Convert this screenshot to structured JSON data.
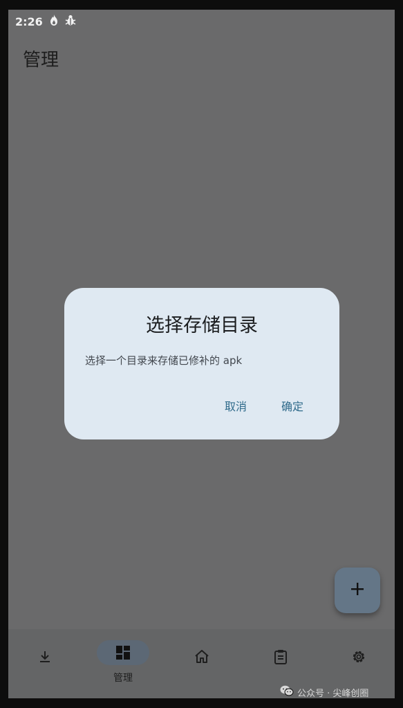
{
  "status_bar": {
    "time": "2:26",
    "notification_icons": [
      "flame-icon",
      "bug-icon"
    ]
  },
  "page": {
    "title": "管理"
  },
  "dialog": {
    "title": "选择存储目录",
    "message": "选择一个目录来存储已修补的 apk",
    "cancel_label": "取消",
    "confirm_label": "确定"
  },
  "fab": {
    "icon": "plus-icon"
  },
  "bottom_nav": {
    "items": [
      {
        "icon": "download-icon",
        "label": ""
      },
      {
        "icon": "dashboard-icon",
        "label": "管理",
        "active": true
      },
      {
        "icon": "home-icon",
        "label": ""
      },
      {
        "icon": "clipboard-icon",
        "label": ""
      },
      {
        "icon": "gear-icon",
        "label": ""
      }
    ]
  },
  "watermark": {
    "text": "公众号 · 尖峰创圈",
    "icon": "wechat-icon"
  },
  "colors": {
    "scrim": "#6a6a6b",
    "dialog_bg": "#dfe9f2",
    "accent": "#2f6a8a",
    "fab_bg": "#647687"
  }
}
